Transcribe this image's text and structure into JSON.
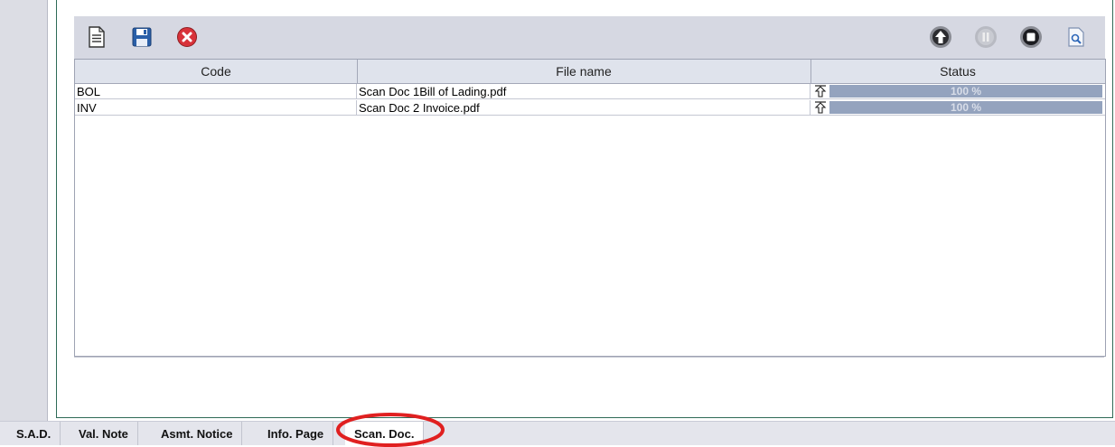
{
  "table": {
    "columns": [
      "Code",
      "File name",
      "Status"
    ],
    "rows": [
      {
        "code": "BOL",
        "file_name": "Scan Doc 1Bill of Lading.pdf",
        "status_text": "100 %",
        "progress": 1.0
      },
      {
        "code": "INV",
        "file_name": "Scan Doc 2 Invoice.pdf",
        "status_text": "100 %",
        "progress": 1.0
      }
    ]
  },
  "toolbar": {
    "left_icons": [
      "new-document-icon",
      "save-icon",
      "delete-icon"
    ],
    "right_icons": [
      "upload-icon",
      "pause-icon",
      "stop-icon",
      "preview-icon"
    ]
  },
  "tabs": [
    {
      "label": "S.A.D.",
      "active": false
    },
    {
      "label": "Val. Note",
      "active": false
    },
    {
      "label": "Asmt. Notice",
      "active": false
    },
    {
      "label": "Info. Page",
      "active": false
    },
    {
      "label": "Scan. Doc.",
      "active": true
    }
  ],
  "colors": {
    "toolbar_bg": "#d6d8e2",
    "progress_bar": "#94a3be",
    "frame_border": "#2f6b57",
    "annotation_circle": "#e02020"
  }
}
